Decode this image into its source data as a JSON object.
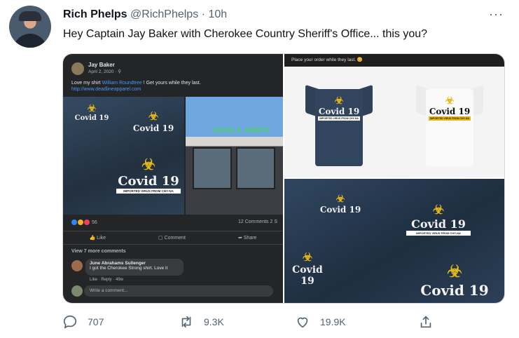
{
  "tweet": {
    "author_name": "Rich Phelps",
    "handle": "@RichPhelps",
    "separator": "·",
    "time": "10h",
    "more": "···",
    "text": "Hey Captain Jay Baker with Cherokee Country Sheriff's Office... this you?"
  },
  "fb_post": {
    "author": "Jay Baker",
    "date": "April 2, 2020 · ⚲",
    "text_before": "Love my shirt ",
    "mention": "William Roundtree",
    "text_after": " ! Get yours while they last.",
    "link": "http://www.deadlineapparel.com",
    "store_sign": "SIGNS & SHIRTS",
    "reaction_count": "56",
    "comments_shares": "12 Comments  2 S",
    "like_label": "Like",
    "comment_label": "Comment",
    "share_label": "Share",
    "view_more": "View 7 more comments",
    "comment_author": "June Abrahams Sullenger",
    "comment_text": "I got the Cherokee Strong shirt. Love it",
    "comment_meta": "Like · Reply · 49w",
    "write_placeholder": "Write a comment..."
  },
  "shirt_art": {
    "biohazard": "☣",
    "title": "Covid 19",
    "band": "IMPORTED VIRUS FROM CHY-NA"
  },
  "order_caption": "Place your order while they last. 😊",
  "actions": {
    "reply_count": "707",
    "retweet_count": "9.3K",
    "like_count": "19.9K"
  },
  "colors": {
    "accent_gold": "#e5b818",
    "muted_text": "#536471",
    "fb_background": "#242526"
  }
}
